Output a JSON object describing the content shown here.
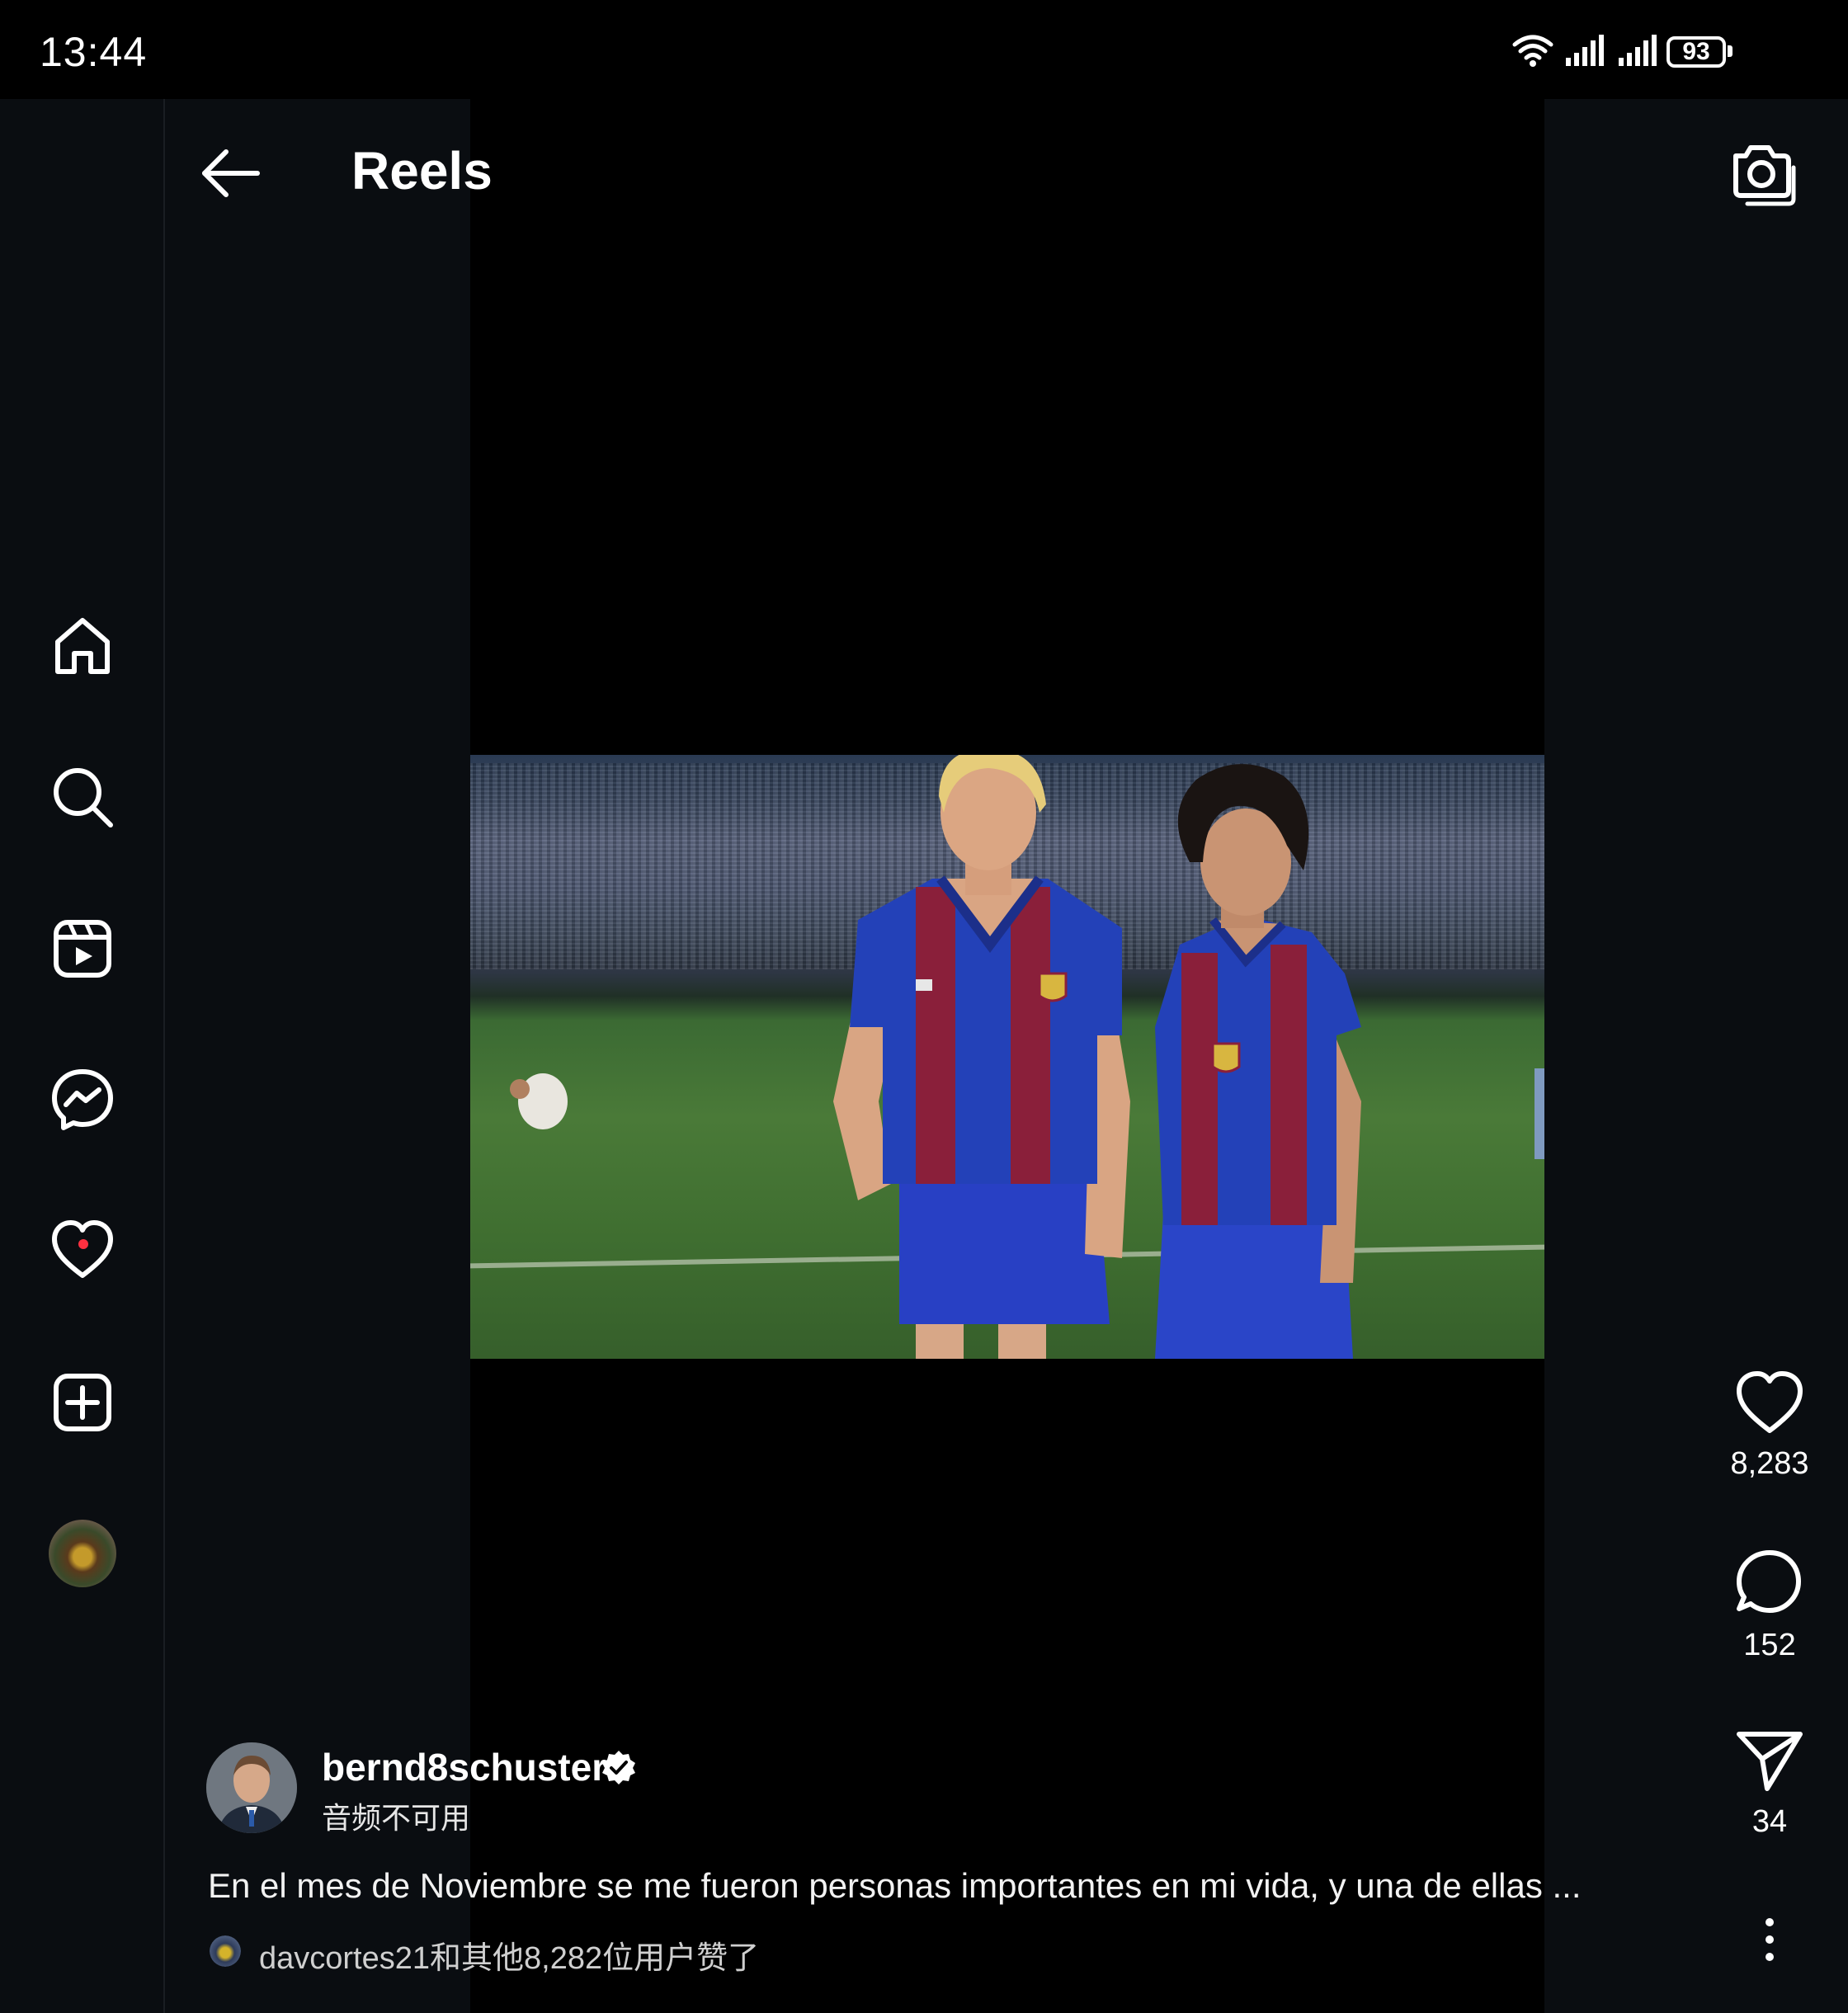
{
  "status_bar": {
    "time": "13:44",
    "battery": "93",
    "icons": [
      "wifi-icon",
      "cell-signal-icon",
      "cell-signal-icon",
      "battery-icon"
    ]
  },
  "header": {
    "title": "Reels",
    "back_icon": "arrow-left-icon",
    "camera_icon": "camera-icon"
  },
  "nav": {
    "items": [
      {
        "name": "home",
        "icon": "home-icon"
      },
      {
        "name": "search",
        "icon": "search-icon"
      },
      {
        "name": "reels",
        "icon": "reels-icon"
      },
      {
        "name": "messenger",
        "icon": "messenger-icon"
      },
      {
        "name": "notifications",
        "icon": "heart-icon",
        "has_dot": true
      },
      {
        "name": "create",
        "icon": "plus-square-icon"
      },
      {
        "name": "profile",
        "icon": "avatar"
      }
    ]
  },
  "actions": {
    "likes": "8,283",
    "comments": "152",
    "shares": "34"
  },
  "post": {
    "author": "bernd8schuster",
    "audio_status": "音频不可用",
    "caption": "En el mes  de Noviembre se me fueron personas importantes en mi vida, y una de ellas ...",
    "liked_by": "davcortes21和其他8,282位用户赞了"
  },
  "colors": {
    "background": "#000000",
    "rail": "#0a0d11",
    "notification_dot": "#ff3040",
    "jersey_blue": "#1f3fb5",
    "jersey_red": "#8a1f3a"
  }
}
